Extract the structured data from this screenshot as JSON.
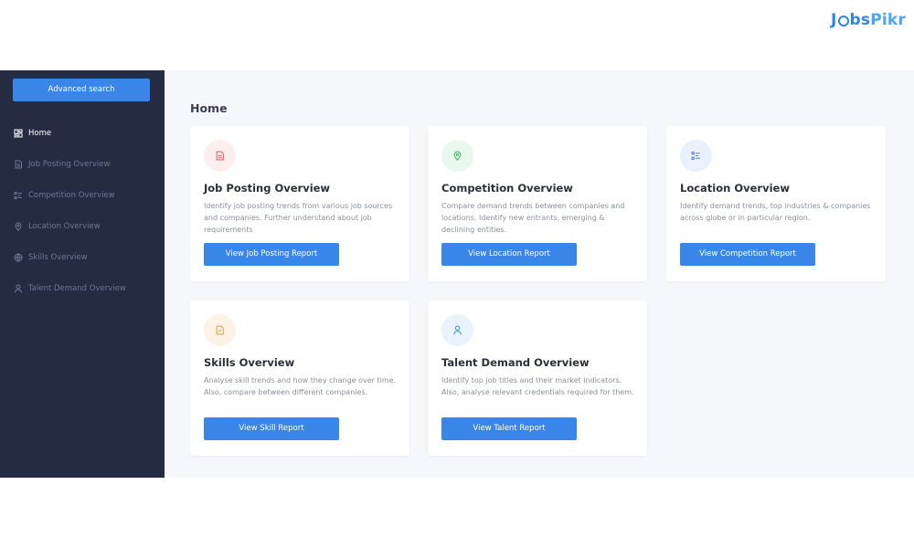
{
  "brand": {
    "logo_text_start": "J",
    "logo_text_mid": "bs",
    "logo_text_end": "Pikr",
    "color": "#2f86e6"
  },
  "sidebar": {
    "search_button": "Advanced search",
    "items": [
      {
        "label": "Home",
        "icon": "home-icon",
        "active": true
      },
      {
        "label": "Job Posting Overview",
        "icon": "document-icon",
        "active": false
      },
      {
        "label": "Competition Overview",
        "icon": "list-icon",
        "active": false
      },
      {
        "label": "Location Overview",
        "icon": "location-pin-icon",
        "active": false
      },
      {
        "label": "Skills Overview",
        "icon": "globe-icon",
        "active": false
      },
      {
        "label": "Talent Demand Overview",
        "icon": "user-icon",
        "active": false
      }
    ]
  },
  "main": {
    "title": "Home",
    "cards": [
      {
        "title": "Job Posting Overview",
        "description": "Identify job posting trends from various job sources and companies. Further understand about job requirements",
        "button": "View Job Posting Report",
        "icon": "document-icon",
        "badge_color": "#fdeeee",
        "icon_color": "#e06b6b"
      },
      {
        "title": "Competition Overview",
        "description": "Compare demand trends between companies and locations. Identify new entrants, emerging & declining entities.",
        "button": "View Location Report",
        "icon": "location-pin-icon",
        "badge_color": "#e9f8ee",
        "icon_color": "#4cbb6c"
      },
      {
        "title": "Location Overview",
        "description": "Identify demand trends, top industries & companies across globe or in particular region.",
        "button": "View Competition Report",
        "icon": "list-icon",
        "badge_color": "#eaf0fc",
        "icon_color": "#5b83d8"
      },
      {
        "title": "Skills Overview",
        "description": "Analyse skill trends and how they change over time. Also, compare between different companies.",
        "button": "View Skill Report",
        "icon": "checklist-icon",
        "badge_color": "#fdf2e6",
        "icon_color": "#e8a654"
      },
      {
        "title": "Talent Demand Overview",
        "description": "Identify top job titles and their market indicators. Also, analyse relevant credentials required for them.",
        "button": "View Talent Report",
        "icon": "user-icon",
        "badge_color": "#e8f3fc",
        "icon_color": "#4c9bdc"
      }
    ]
  },
  "colors": {
    "sidebar_bg": "#252c41",
    "accent": "#3a86e8",
    "main_bg": "#f6f7fa"
  }
}
